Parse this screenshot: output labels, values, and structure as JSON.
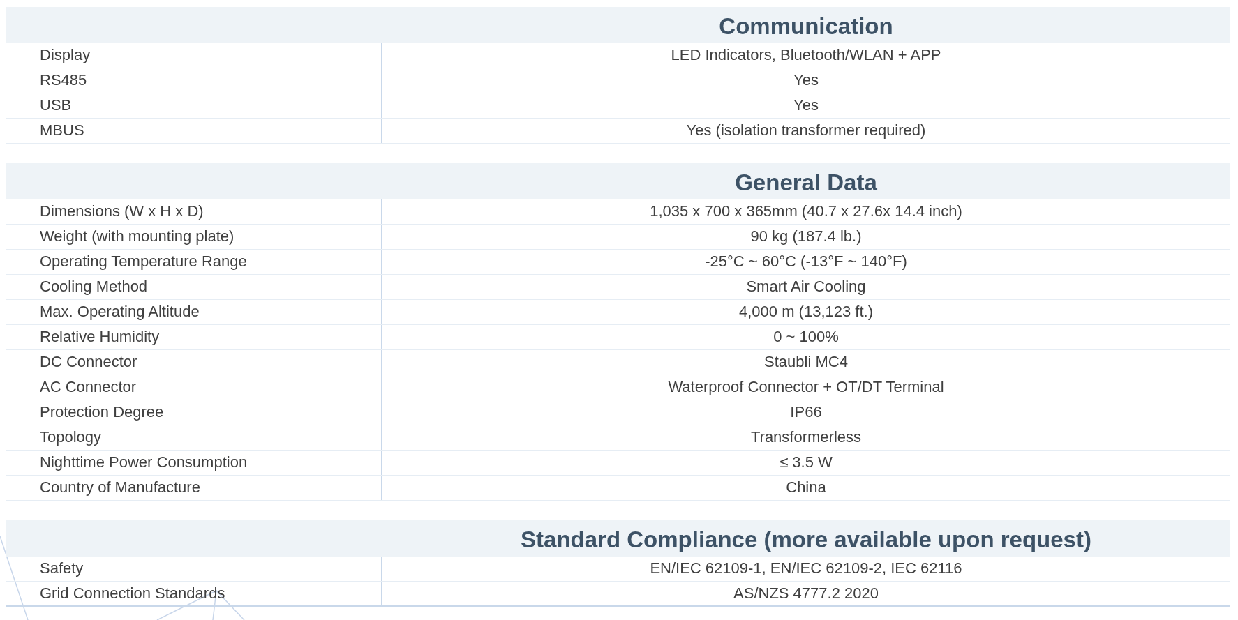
{
  "sections": [
    {
      "title": "Communication",
      "rows": [
        {
          "label": "Display",
          "value": "LED Indicators, Bluetooth/WLAN + APP"
        },
        {
          "label": "RS485",
          "value": "Yes"
        },
        {
          "label": "USB",
          "value": "Yes"
        },
        {
          "label": "MBUS",
          "value": "Yes (isolation transformer required)"
        }
      ]
    },
    {
      "title": "General Data",
      "rows": [
        {
          "label": "Dimensions (W x H x D)",
          "value": "1,035 x 700 x 365mm (40.7 x 27.6x 14.4 inch)"
        },
        {
          "label": "Weight (with mounting plate)",
          "value": "90 kg (187.4 lb.)"
        },
        {
          "label": "Operating Temperature Range",
          "value": "-25°C ~ 60°C (-13°F ~ 140°F)"
        },
        {
          "label": "Cooling Method",
          "value": "Smart Air Cooling"
        },
        {
          "label": "Max. Operating Altitude",
          "value": "4,000 m (13,123 ft.)"
        },
        {
          "label": "Relative Humidity",
          "value": "0 ~ 100%"
        },
        {
          "label": "DC Connector",
          "value": "Staubli MC4"
        },
        {
          "label": "AC Connector",
          "value": "Waterproof Connector + OT/DT Terminal"
        },
        {
          "label": "Protection Degree",
          "value": "IP66"
        },
        {
          "label": "Topology",
          "value": "Transformerless"
        },
        {
          "label": "Nighttime Power Consumption",
          "value": "≤ 3.5 W"
        },
        {
          "label": "Country of Manufacture",
          "value": "China"
        }
      ]
    },
    {
      "title": "Standard Compliance (more available upon request)",
      "rows": [
        {
          "label": "Safety",
          "value": "EN/IEC 62109-1, EN/IEC 62109-2, IEC 62116"
        },
        {
          "label": "Grid Connection Standards",
          "value": "AS/NZS 4777.2 2020"
        }
      ]
    }
  ]
}
